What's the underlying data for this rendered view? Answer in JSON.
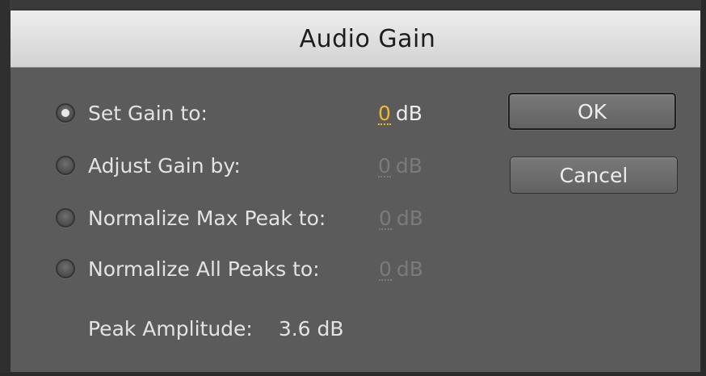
{
  "dialog": {
    "title": "Audio Gain"
  },
  "options": [
    {
      "label": "Set Gain to:",
      "value": "0",
      "unit": "dB",
      "selected": true,
      "enabled": true
    },
    {
      "label": "Adjust Gain by:",
      "value": "0",
      "unit": "dB",
      "selected": false,
      "enabled": false
    },
    {
      "label": "Normalize Max Peak to:",
      "value": "0",
      "unit": "dB",
      "selected": false,
      "enabled": false
    },
    {
      "label": "Normalize All Peaks to:",
      "value": "0",
      "unit": "dB",
      "selected": false,
      "enabled": false
    }
  ],
  "peak": {
    "label": "Peak Amplitude:",
    "value": "3.6 dB"
  },
  "buttons": {
    "ok_label": "OK",
    "cancel_label": "Cancel"
  },
  "colors": {
    "accent_value": "#f0b92a",
    "panel": "#5b5b5b"
  }
}
